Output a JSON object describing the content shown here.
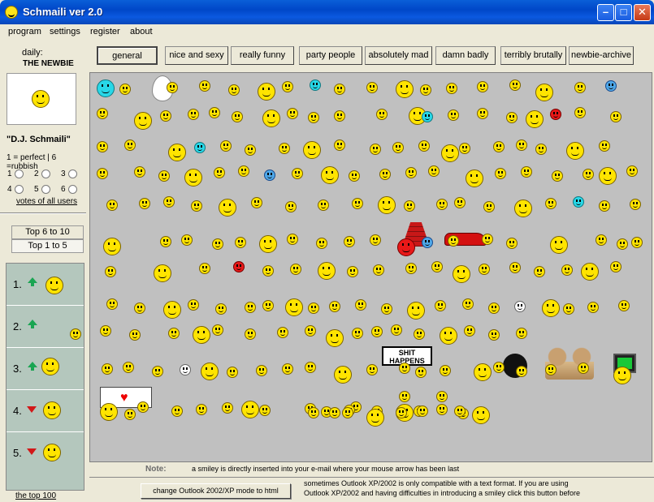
{
  "window": {
    "title": "Schmaili ver 2.0"
  },
  "menu": {
    "items": [
      "program",
      "settings",
      "register",
      "about"
    ]
  },
  "sidebar": {
    "daily_label": "daily:",
    "daily_name": "THE NEWBIE",
    "dj_name": "\"D.J. Schmaili\"",
    "rating_legend": "1 = perfect  | 6 =rubbish",
    "ratings": [
      "1",
      "2",
      "3",
      "4",
      "5",
      "6"
    ],
    "votes_link": "votes of all users",
    "top_tabs": [
      "Top 6 to 10",
      "Top 1 to 5"
    ],
    "top_items": [
      {
        "rank": "1.",
        "trend": "up"
      },
      {
        "rank": "2.",
        "trend": "up"
      },
      {
        "rank": "3.",
        "trend": "up"
      },
      {
        "rank": "4.",
        "trend": "down"
      },
      {
        "rank": "5.",
        "trend": "down"
      }
    ],
    "top100_link": "the top 100"
  },
  "tabs": [
    "general",
    "nice and sexy",
    "really funny",
    "party people",
    "absolutely mad",
    "damn badly",
    "terribly brutally",
    "newbie-archive"
  ],
  "active_tab": "general",
  "signs": {
    "shit_happens": "SHIT\nHAPPENS"
  },
  "note": {
    "label": "Note:",
    "text": "a smiley is directly inserted into your e-mail where your mouse arrow has been last"
  },
  "bottom": {
    "convert_button": "change Outlook 2002/XP mode  to html",
    "info_line1": "sometimes Outlook XP/2002 is only compatible with a text format.  If you are using",
    "info_line2": "Outlook XP/2002 and having difficulties in introducing a smiley click this button before"
  }
}
